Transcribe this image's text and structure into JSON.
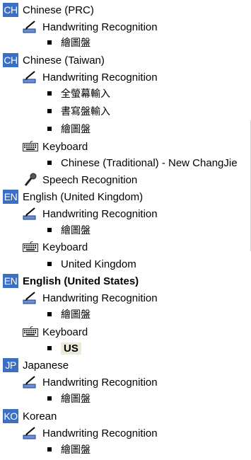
{
  "tree": {
    "chinese_prc": {
      "badge": "CH",
      "label": "Chinese (PRC)",
      "handwriting": {
        "label": "Handwriting Recognition",
        "items": [
          "繪圖盤"
        ]
      }
    },
    "chinese_taiwan": {
      "badge": "CH",
      "label": "Chinese (Taiwan)",
      "handwriting": {
        "label": "Handwriting Recognition",
        "items": [
          "全螢幕輸入",
          "書寫盤輸入",
          "繪圖盤"
        ]
      },
      "keyboard": {
        "label": "Keyboard",
        "items": [
          "Chinese (Traditional) - New ChangJie"
        ]
      },
      "speech": {
        "label": "Speech Recognition"
      }
    },
    "english_uk": {
      "badge": "EN",
      "label": "English (United Kingdom)",
      "handwriting": {
        "label": "Handwriting Recognition",
        "items": [
          "繪圖盤"
        ]
      },
      "keyboard": {
        "label": "Keyboard",
        "items": [
          "United Kingdom"
        ]
      }
    },
    "english_us": {
      "badge": "EN",
      "label": "English (United States)",
      "handwriting": {
        "label": "Handwriting Recognition",
        "items": [
          "繪圖盤"
        ]
      },
      "keyboard": {
        "label": "Keyboard",
        "items": [
          "US"
        ]
      }
    },
    "japanese": {
      "badge": "JP",
      "label": "Japanese",
      "handwriting": {
        "label": "Handwriting Recognition",
        "items": [
          "繪圖盤"
        ]
      }
    },
    "korean": {
      "badge": "KO",
      "label": "Korean",
      "handwriting": {
        "label": "Handwriting Recognition",
        "items": [
          "繪圖盤"
        ]
      }
    }
  },
  "icons": {
    "handwriting": "pen-tablet-icon",
    "keyboard": "keyboard-icon",
    "speech": "microphone-icon"
  },
  "colors": {
    "badge": "#3a6fc4",
    "selection": "#ece9d8"
  }
}
